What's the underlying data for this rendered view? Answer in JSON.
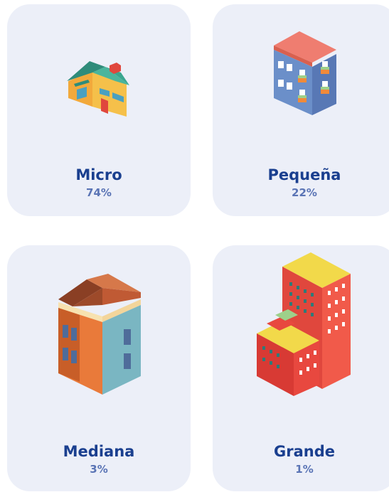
{
  "cards": [
    {
      "label": "Micro",
      "percent": "74%",
      "icon": "small-house-icon"
    },
    {
      "label": "Pequeña",
      "percent": "22%",
      "icon": "townhouse-icon"
    },
    {
      "label": "Mediana",
      "percent": "3%",
      "icon": "mid-building-icon"
    },
    {
      "label": "Grande",
      "percent": "1%",
      "icon": "tower-building-icon"
    }
  ],
  "colors": {
    "card_bg": "#eceff8",
    "label": "#1a3f8f",
    "percent": "#5a74b5"
  }
}
